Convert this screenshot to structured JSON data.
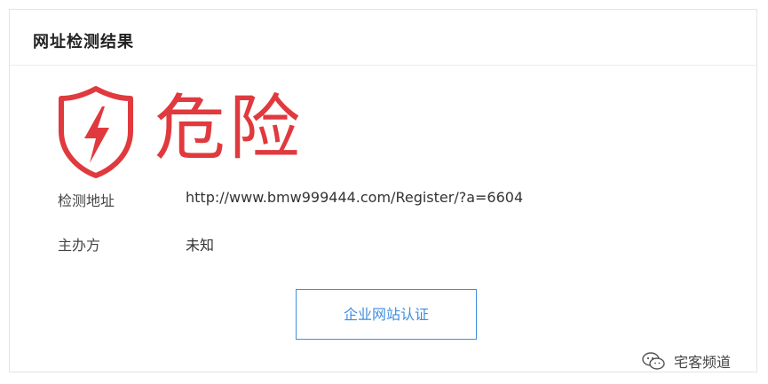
{
  "header": {
    "title": "网址检测结果"
  },
  "result": {
    "status": "危险",
    "status_color": "#e0393e",
    "icon": "danger-shield-icon"
  },
  "details": {
    "url_label": "检测地址",
    "url_value": "http://www.bmw999444.com/Register/?a=6604",
    "org_label": "主办方",
    "org_value": "未知"
  },
  "actions": {
    "certify_label": "企业网站认证",
    "accent_color": "#3e8ee0"
  },
  "watermark": {
    "text": "宅客频道",
    "icon": "wechat-icon"
  }
}
